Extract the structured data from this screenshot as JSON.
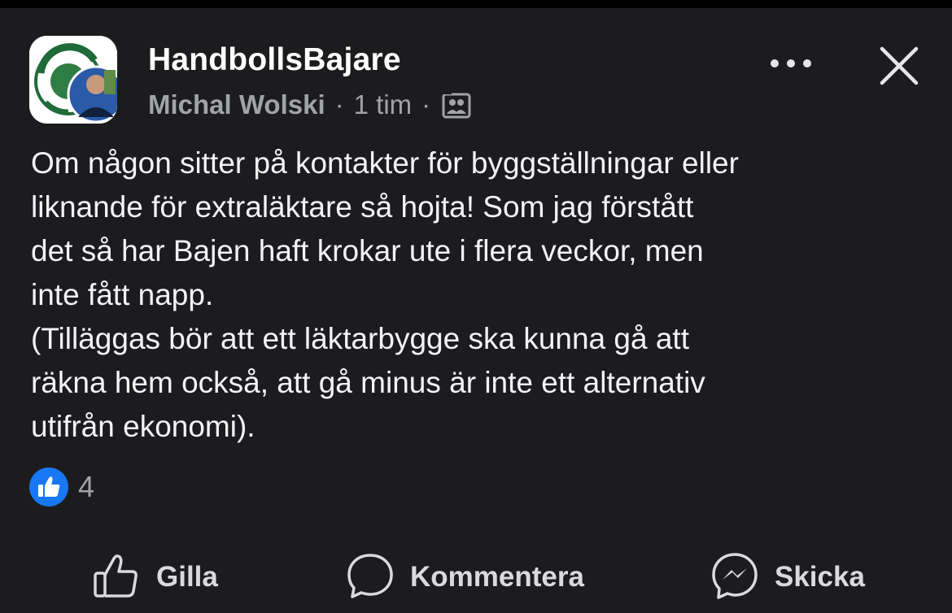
{
  "post": {
    "group_name": "HandbollsBajare",
    "author": "Michal Wolski",
    "separator": "·",
    "time": "1 tim",
    "audience_icon": "group-audience-icon",
    "text": "Om någon sitter på kontakter för byggställningar eller\nliknande för extraläktare så hojta! Som jag förstått\ndet så har Bajen haft krokar ute i flera veckor, men\ninte fått napp.\n(Tilläggas bör att ett läktarbygge ska kunna gå att\nräkna hem också, att gå minus är inte ett alternativ\nutifrån ekonomi).",
    "reaction_icon": "like-reaction-icon",
    "reaction_count": "4"
  },
  "header_controls": {
    "more_icon": "more-options-icon",
    "close_icon": "close-icon"
  },
  "actions": {
    "like_label": "Gilla",
    "comment_label": "Kommentera",
    "send_label": "Skicka"
  },
  "colors": {
    "background": "#1c1c1e",
    "accent": "#1877f2",
    "secondary_text": "#a0a3a8",
    "primary_text": "#f2f3f5"
  }
}
